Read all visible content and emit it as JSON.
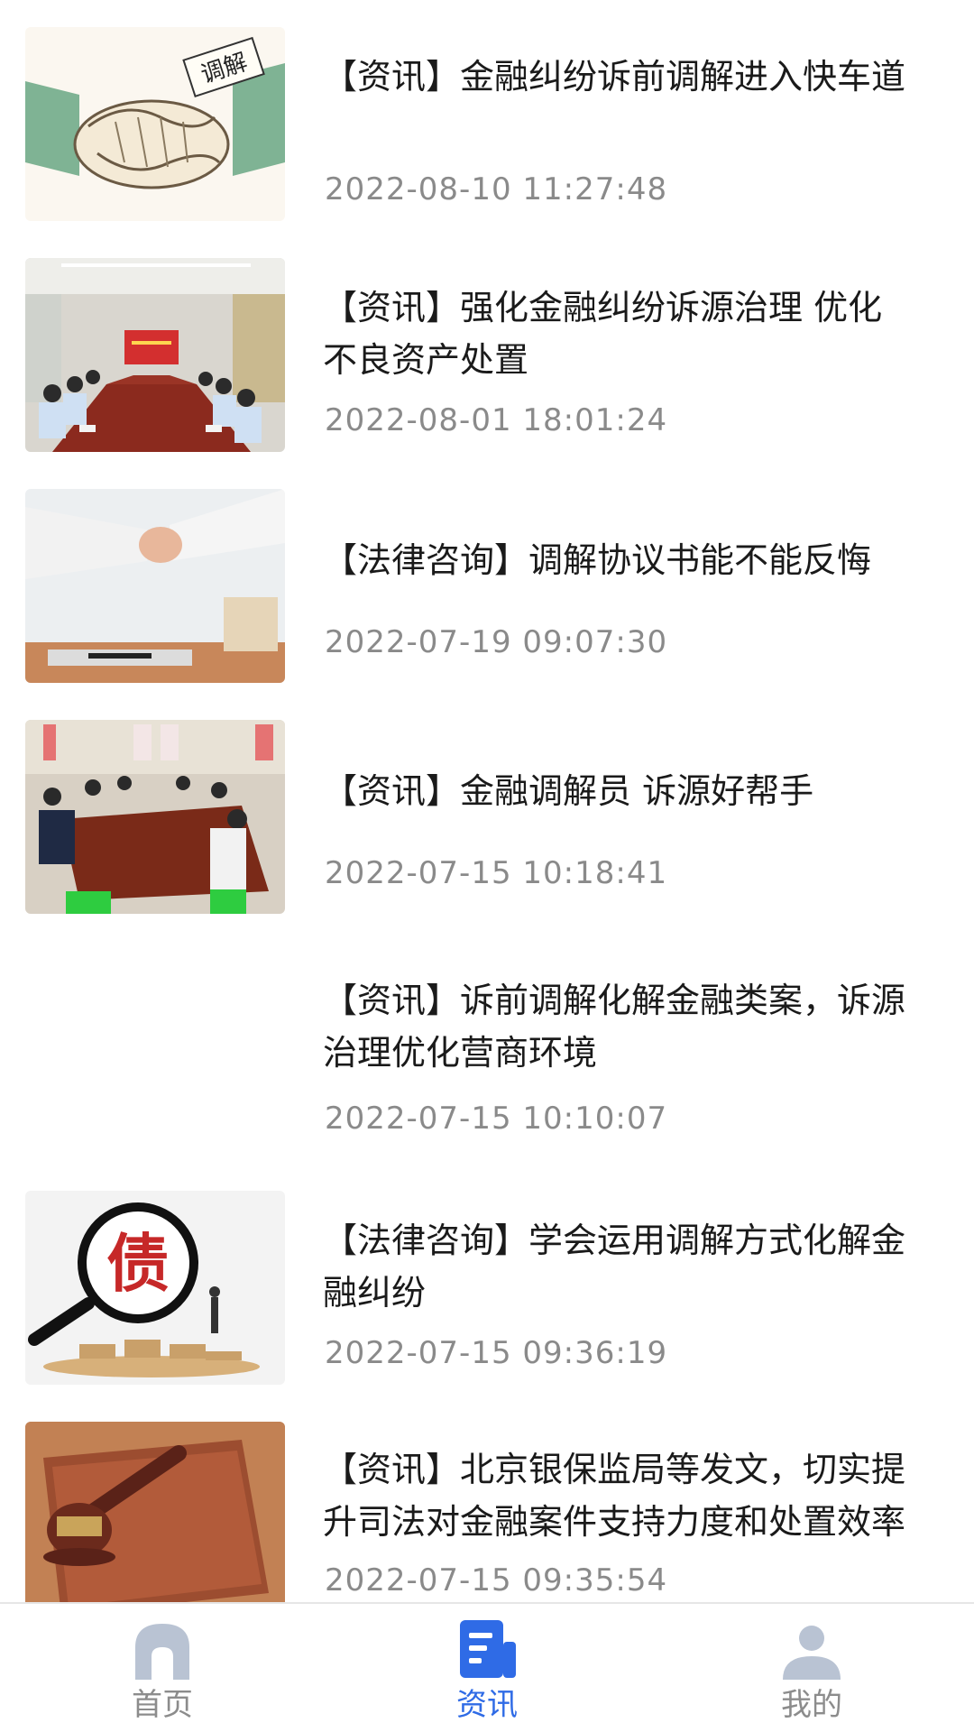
{
  "news": [
    {
      "title": "【资讯】金融纠纷诉前调解进入快车道",
      "time": "2022-08-10 11:27:48",
      "image": "handshake-mediation"
    },
    {
      "title": "【资讯】强化金融纠纷诉源治理 优化不良资产处置",
      "time": "2022-08-01 18:01:24",
      "image": "meeting-room"
    },
    {
      "title": "【法律咨询】调解协议书能不能反悔",
      "time": "2022-07-19 09:07:30",
      "image": "business-handshake"
    },
    {
      "title": "【资讯】金融调解员 诉源好帮手",
      "time": "2022-07-15 10:18:41",
      "image": "meeting-table"
    },
    {
      "title": "【资讯】诉前调解化解金融类案，诉源治理优化营商环境",
      "time": "2022-07-15 10:10:07",
      "image": ""
    },
    {
      "title": "【法律咨询】学会运用调解方式化解金融纠纷",
      "time": "2022-07-15 09:36:19",
      "image": "debt-magnifier"
    },
    {
      "title": "【资讯】北京银保监局等发文，切实提升司法对金融案件支持力度和处置效率",
      "time": "2022-07-15 09:35:54",
      "image": "gavel-book"
    }
  ],
  "tabbar": {
    "items": [
      {
        "label": "首页",
        "icon": "home-icon"
      },
      {
        "label": "资讯",
        "icon": "news-icon"
      },
      {
        "label": "我的",
        "icon": "user-icon"
      }
    ],
    "active_color": "#2f6be6",
    "inactive_color": "#b9c3d3"
  },
  "thumb_texts": {
    "mediation": "调解",
    "debt": "债"
  }
}
